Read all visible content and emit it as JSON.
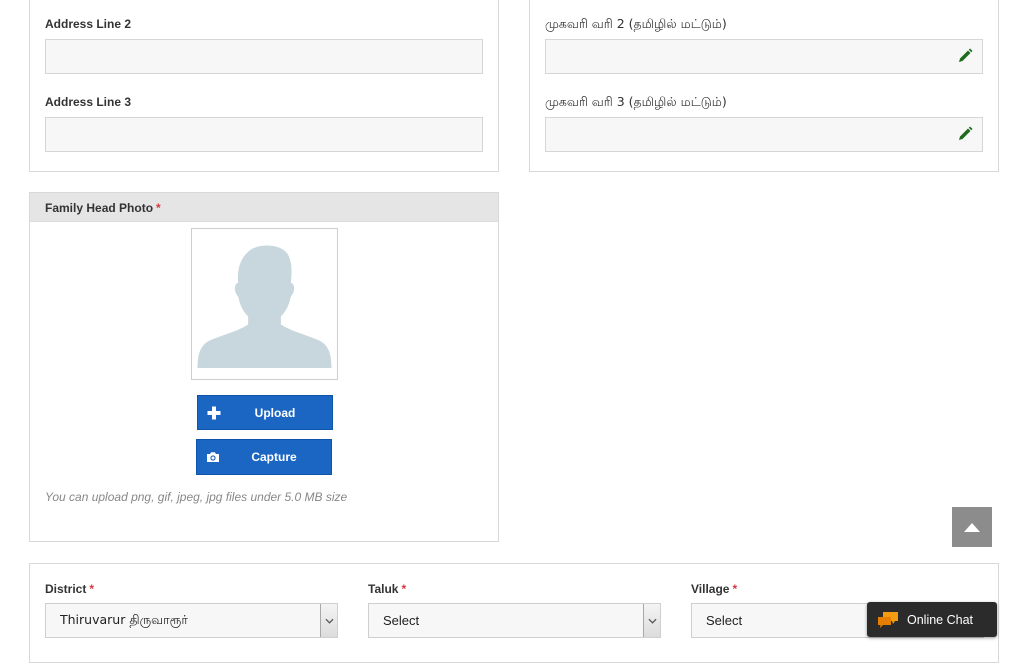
{
  "address_en": {
    "line2_label": "Address Line 2",
    "line2_value": "",
    "line3_label": "Address Line 3",
    "line3_value": ""
  },
  "address_ta": {
    "line2_label": "முகவரி வரி 2 (தமிழில் மட்டும்)",
    "line2_value": "",
    "line3_label": "முகவரி வரி 3 (தமிழில் மட்டும்)",
    "line3_value": ""
  },
  "photo": {
    "heading": "Family Head Photo",
    "required_mark": "*",
    "upload_label": "Upload",
    "capture_label": "Capture",
    "hint": "You can upload png, gif, jpeg, jpg files under 5.0 MB size"
  },
  "location": {
    "district_label": "District",
    "district_value": "Thiruvarur திருவாரூர்",
    "taluk_label": "Taluk",
    "taluk_value": "Select",
    "village_label": "Village",
    "village_value": "Select",
    "required_mark": "*"
  },
  "chat": {
    "label": "Online Chat"
  },
  "colors": {
    "primary_button": "#1a66c2",
    "required": "#d9363e",
    "edit_icon": "#1e6b1e",
    "chat_icon": "#f39c12"
  },
  "icons": {
    "edit": "pencil-icon",
    "upload": "plus-icon",
    "capture": "camera-icon",
    "back_to_top": "caret-up-icon",
    "chat": "chat-bubbles-icon",
    "dropdown": "chevron-down-icon"
  }
}
